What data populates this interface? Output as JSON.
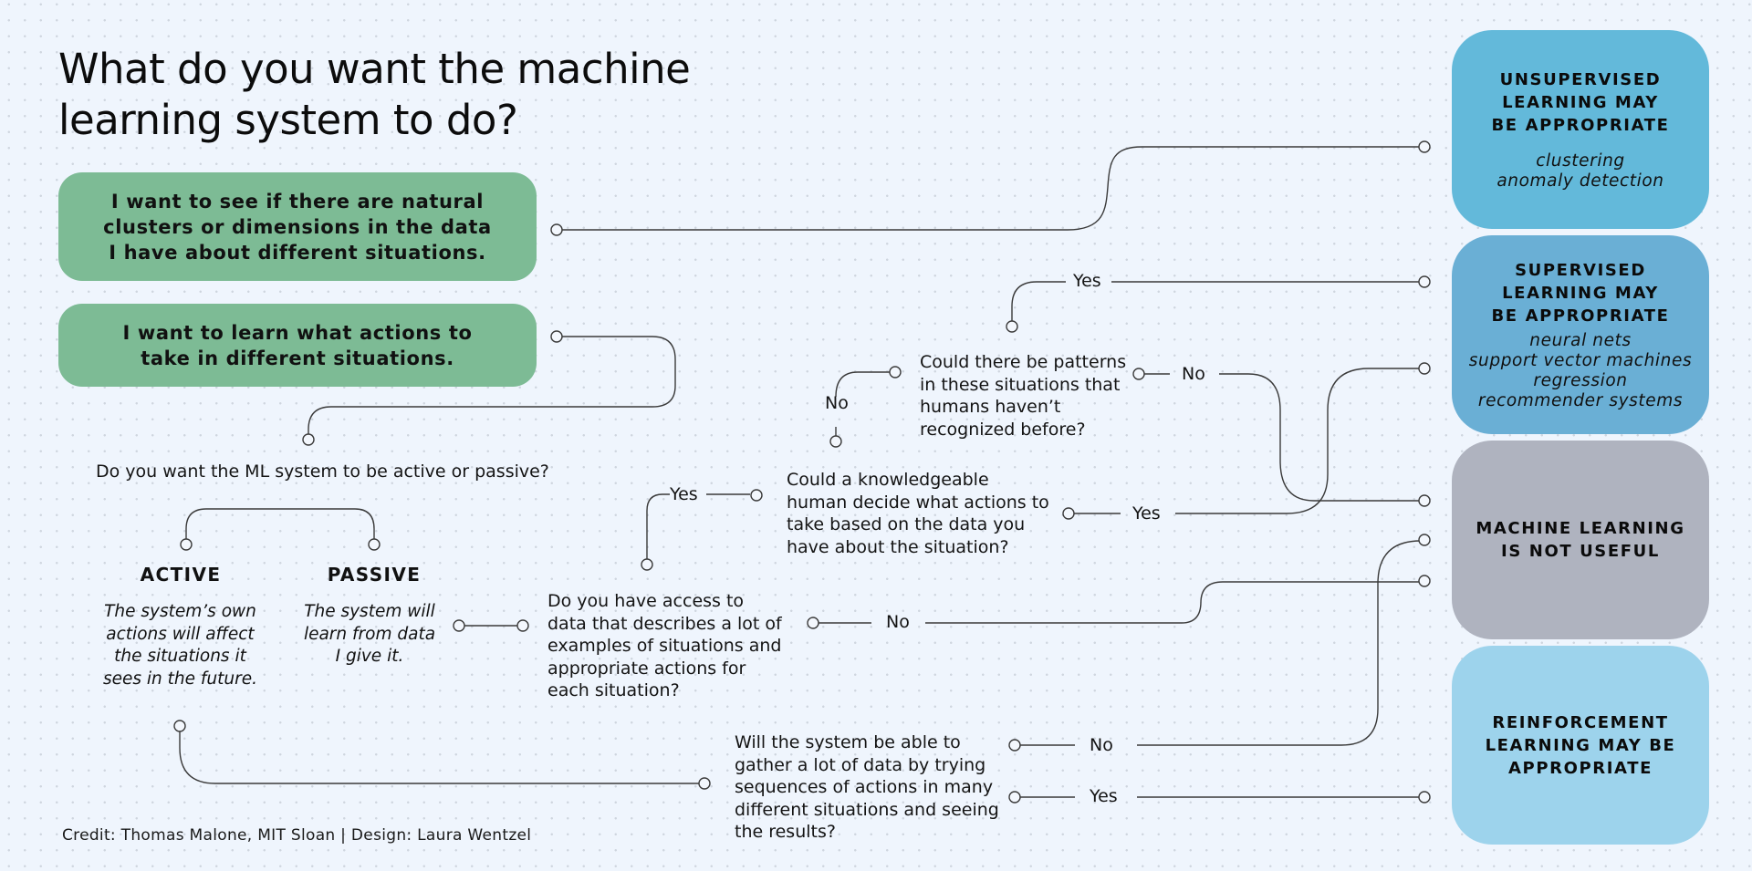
{
  "title": "What do you want the machine learning system to do?",
  "goals": {
    "clusters": "I want to see if there are natural clusters or dimensions in the data I have about different situations.",
    "actions": "I want to learn what actions to take in different situations."
  },
  "questions": {
    "active_passive": "Do you want the ML system to be active or passive?",
    "access_data": "Do you have access to data that describes a lot of examples of situations and appropriate actions for each situation?",
    "knowledgeable_human": "Could a knowledgeable human decide what actions to take based on the data you have about the situation?",
    "patterns": "Could there be patterns in these situations that humans haven’t recognized before?",
    "gather_data": "Will the system be able to gather a lot of data by trying sequences of actions in many different situations and seeing the results?"
  },
  "modes": {
    "active": {
      "title": "ACTIVE",
      "description": "The system’s own actions will affect the situations it sees in the future."
    },
    "passive": {
      "title": "PASSIVE",
      "description": "The system will learn from data I give it."
    }
  },
  "answers": {
    "yes": "Yes",
    "no": "No"
  },
  "outcomes": {
    "unsupervised": {
      "title": "UNSUPERVISED LEARNING MAY BE APPROPRIATE",
      "examples": [
        "clustering",
        "anomaly detection"
      ],
      "color": "#63b9da"
    },
    "supervised": {
      "title": "SUPERVISED LEARNING MAY BE APPROPRIATE",
      "examples": [
        "neural nets",
        "support vector machines",
        "regression",
        "recommender systems"
      ],
      "color": "#6aafd5"
    },
    "not_useful": {
      "title": "MACHINE LEARNING IS NOT USEFUL",
      "examples": [],
      "color": "#afb3bf"
    },
    "reinforcement": {
      "title": "REINFORCEMENT LEARNING MAY BE APPROPRIATE",
      "examples": [],
      "color": "#9dd3ec"
    }
  },
  "colors": {
    "background": "#eff5fd",
    "goal_box": "#7dbb95",
    "connector": "#3a3a3a"
  },
  "credit": "Credit: Thomas Malone, MIT Sloan | Design: Laura Wentzel"
}
